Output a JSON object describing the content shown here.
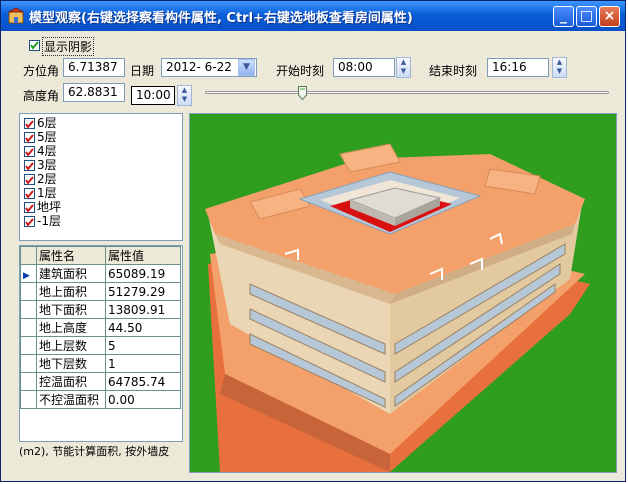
{
  "window": {
    "title": "模型观察(右键选择察看构件属性, Ctrl+右键选地板查看房间属性)",
    "min_glyph": "_",
    "max_glyph": "□",
    "close_glyph": "×"
  },
  "controls": {
    "show_shadow_label": "显示阴影",
    "show_shadow_checked": true,
    "azimuth_label": "方位角",
    "azimuth_value": "6.71387",
    "altitude_label": "高度角",
    "altitude_value": "62.8831",
    "date_label": "日期",
    "date_value": "2012- 6-22",
    "start_time_label": "开始时刻",
    "start_time_value": "08:00",
    "end_time_label": "结束时刻",
    "end_time_value": "16:16",
    "current_time_value": "10:00",
    "time_slider_fraction": 0.24
  },
  "floors": [
    {
      "label": "6层",
      "checked": true
    },
    {
      "label": "5层",
      "checked": true
    },
    {
      "label": "4层",
      "checked": true
    },
    {
      "label": "3层",
      "checked": true
    },
    {
      "label": "2层",
      "checked": true
    },
    {
      "label": "1层",
      "checked": true
    },
    {
      "label": "地坪",
      "checked": true
    },
    {
      "label": "-1层",
      "checked": true
    }
  ],
  "properties": {
    "header_name": "属性名",
    "header_value": "属性值",
    "rows": [
      {
        "name": "建筑面积",
        "value": "65089.19"
      },
      {
        "name": "地上面积",
        "value": "51279.29"
      },
      {
        "name": "地下面积",
        "value": "13809.91"
      },
      {
        "name": "地上高度",
        "value": "44.50"
      },
      {
        "name": "地上层数",
        "value": "5"
      },
      {
        "name": "地下层数",
        "value": "1"
      },
      {
        "name": "控温面积",
        "value": "64785.74"
      },
      {
        "name": "不控温面积",
        "value": "0.00"
      }
    ],
    "selected_index": 0
  },
  "status_text": "(m2), 节能计算面积, 按外墙皮",
  "colors": {
    "ground": "#2f9e1f",
    "roof": "#f4a06a",
    "wall": "#e8d3b0",
    "glass": "#b6c8d8",
    "red_highlight": "#d81010"
  }
}
